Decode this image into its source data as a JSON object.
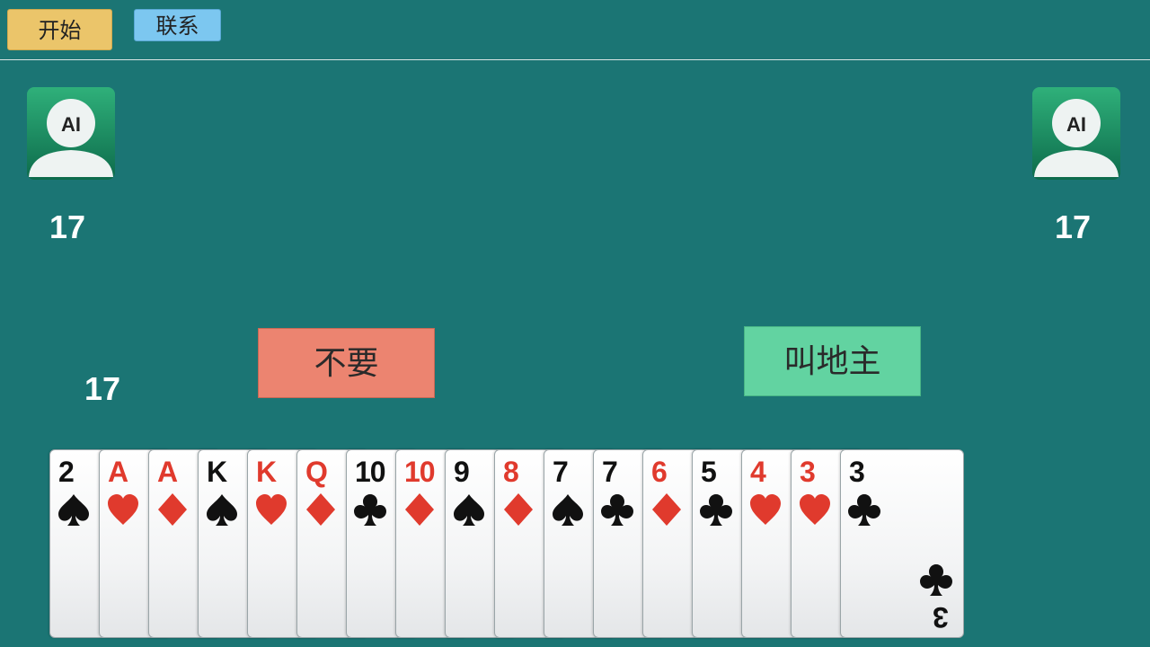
{
  "toolbar": {
    "start_label": "开始",
    "contact_label": "联系"
  },
  "players": {
    "left": {
      "avatar_text": "AI",
      "card_count": "17"
    },
    "right": {
      "avatar_text": "AI",
      "card_count": "17"
    },
    "me": {
      "card_count": "17"
    }
  },
  "actions": {
    "pass_label": "不要",
    "bid_label": "叫地主"
  },
  "hand": [
    {
      "rank": "2",
      "suit": "spade"
    },
    {
      "rank": "A",
      "suit": "heart"
    },
    {
      "rank": "A",
      "suit": "diamond"
    },
    {
      "rank": "K",
      "suit": "spade"
    },
    {
      "rank": "K",
      "suit": "heart"
    },
    {
      "rank": "Q",
      "suit": "diamond"
    },
    {
      "rank": "10",
      "suit": "club"
    },
    {
      "rank": "10",
      "suit": "diamond"
    },
    {
      "rank": "9",
      "suit": "spade"
    },
    {
      "rank": "8",
      "suit": "diamond"
    },
    {
      "rank": "7",
      "suit": "spade"
    },
    {
      "rank": "7",
      "suit": "club"
    },
    {
      "rank": "6",
      "suit": "diamond"
    },
    {
      "rank": "5",
      "suit": "club"
    },
    {
      "rank": "4",
      "suit": "heart"
    },
    {
      "rank": "3",
      "suit": "heart"
    },
    {
      "rank": "3",
      "suit": "club"
    }
  ],
  "colors": {
    "table": "#1b7574",
    "red_suit": "#e03a2d",
    "black_suit": "#111111",
    "pass_button": "#ec8470",
    "bid_button": "#62d3a1"
  }
}
